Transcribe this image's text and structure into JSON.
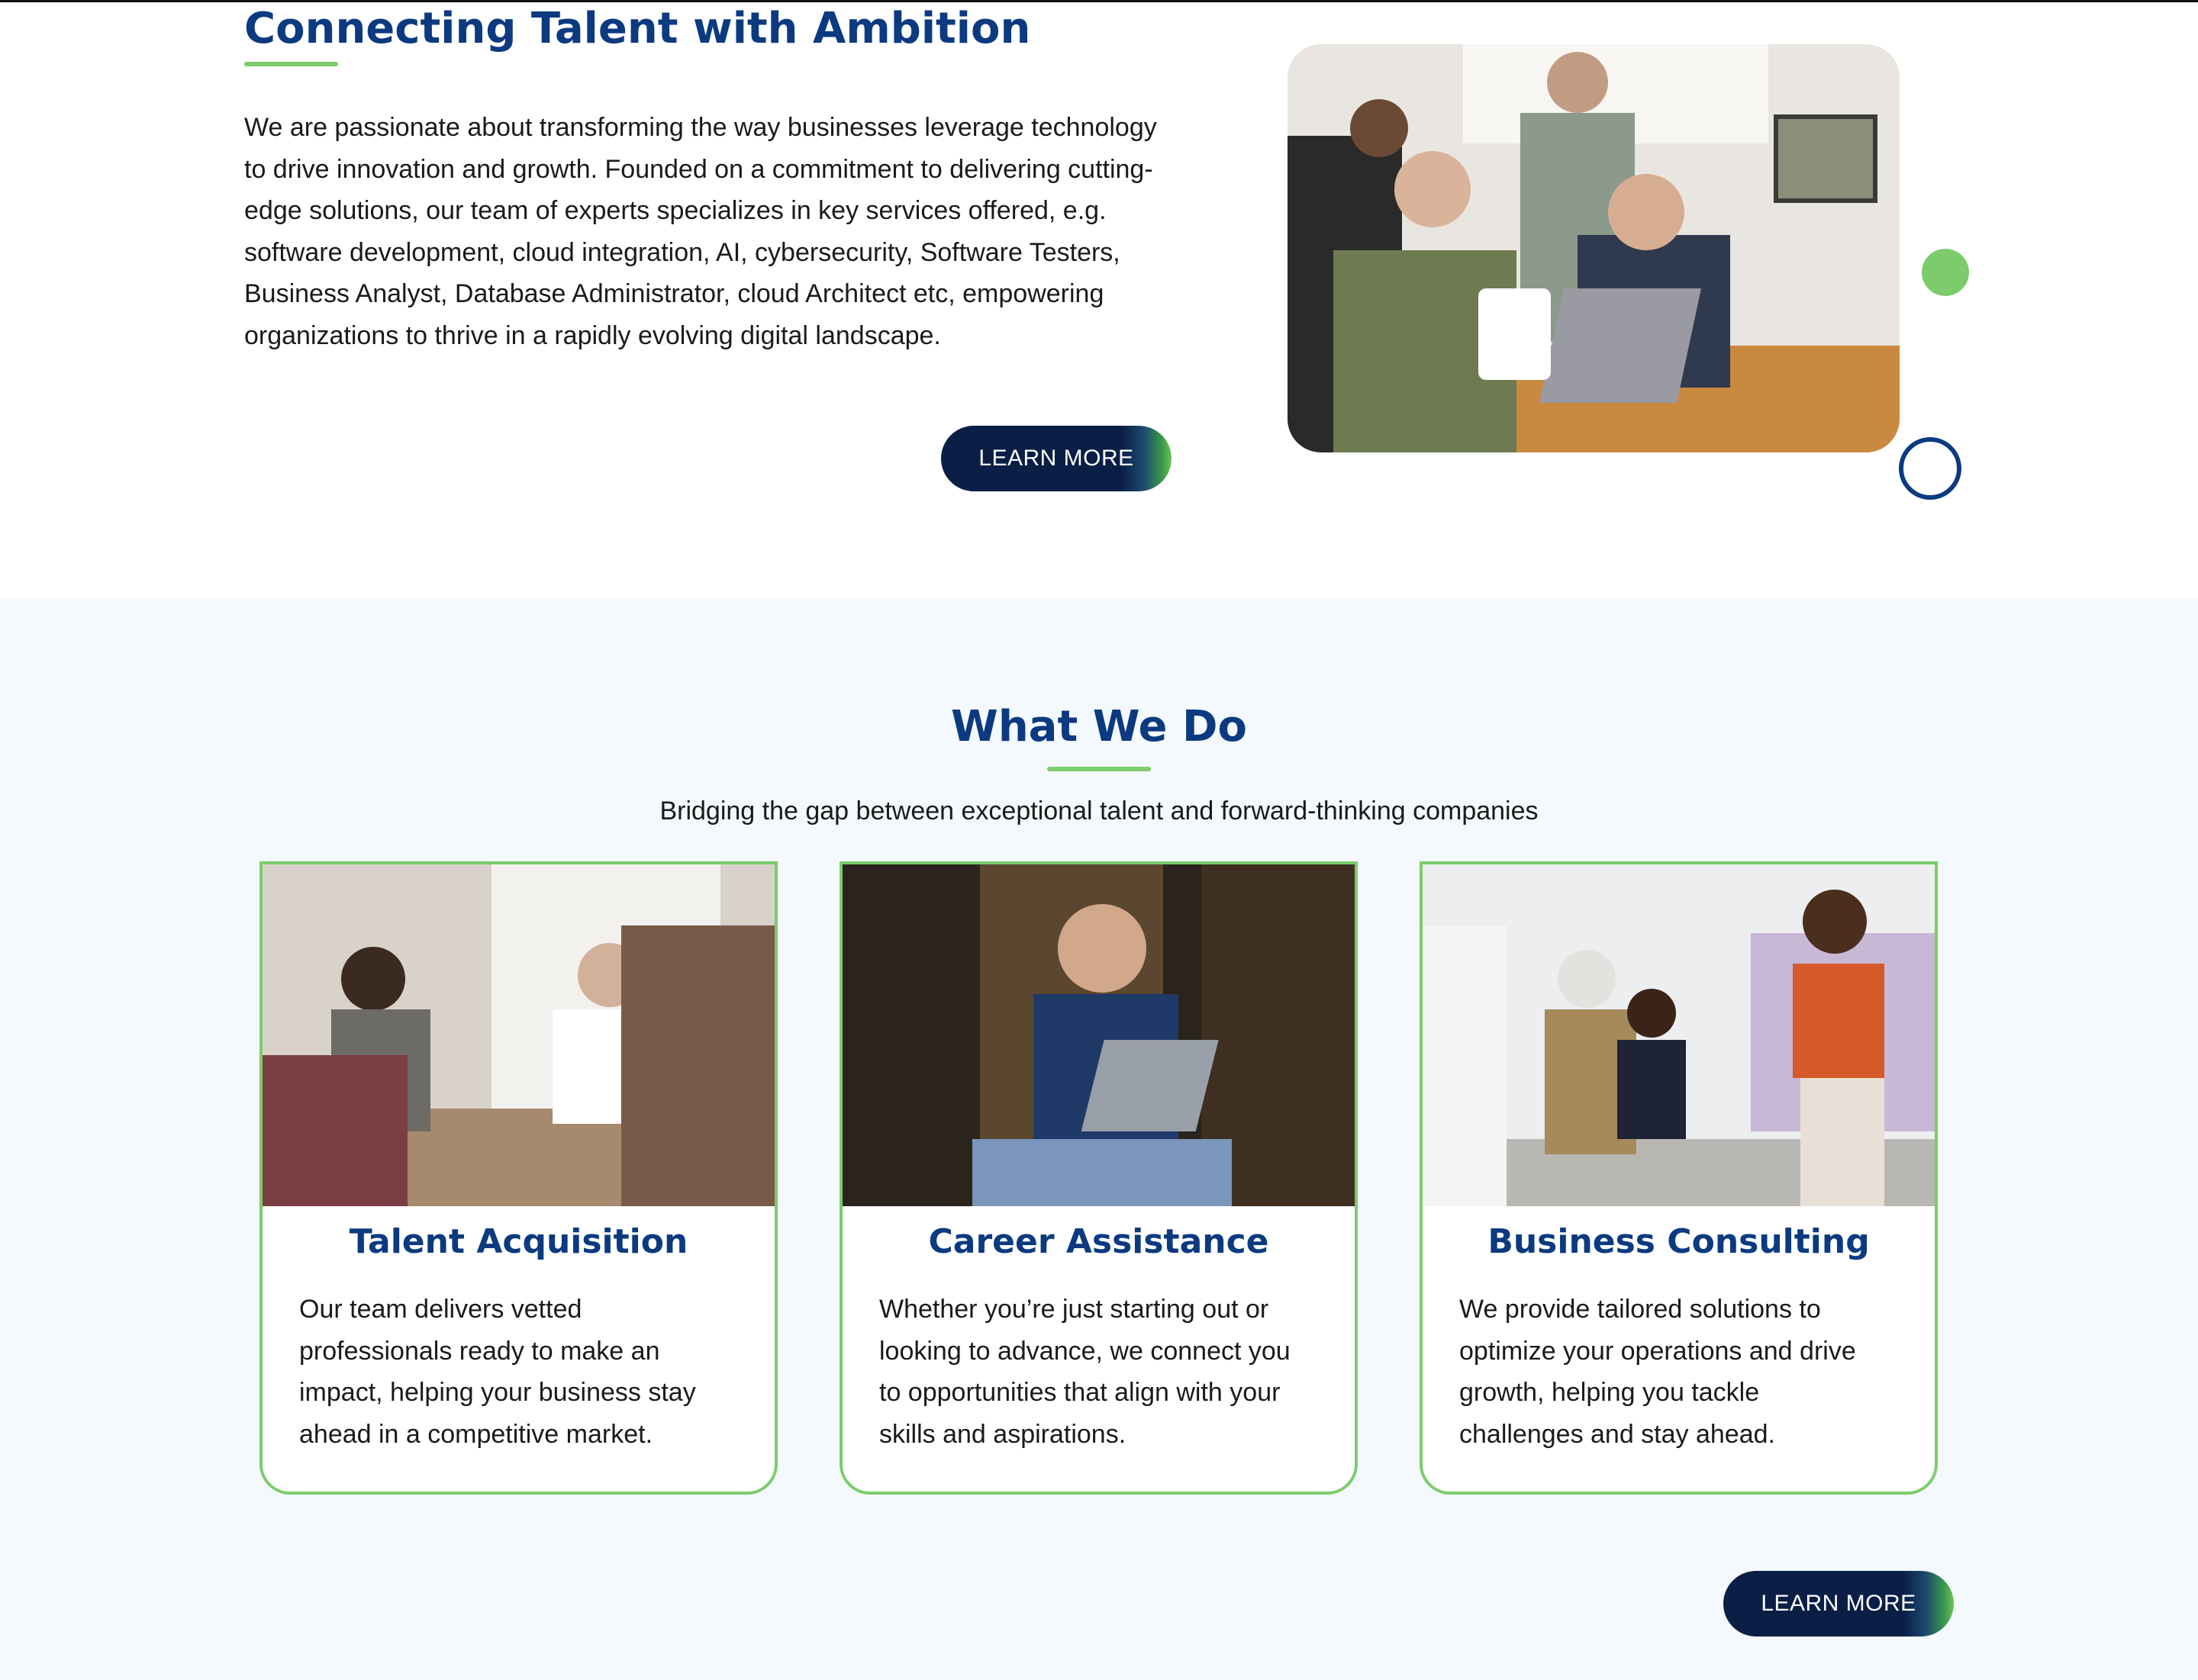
{
  "about": {
    "title": "Connecting Talent with Ambition",
    "body": "We are passionate about transforming the way businesses leverage technology to drive innovation and growth. Founded on a commitment to delivering cutting-edge solutions, our team of experts specializes in key services offered, e.g. software development, cloud integration, AI, cybersecurity, Software Testers, Business Analyst, Database Administrator, cloud Architect  etc, empowering organizations to thrive in a rapidly evolving digital landscape.",
    "button_label": "LEARN MORE",
    "photo_alt": "team collaborating at a laptop"
  },
  "services": {
    "title": "What We Do",
    "subtitle": "Bridging the gap between exceptional talent and forward-thinking companies",
    "cards": [
      {
        "title": "Talent Acquisition",
        "body": "Our team delivers vetted professionals ready to make an impact, helping your business stay ahead in a competitive market."
      },
      {
        "title": "Career Assistance",
        "body": "Whether you’re just starting out or looking to advance, we connect you to opportunities that align with your skills and aspirations."
      },
      {
        "title": "Business Consulting",
        "body": "We provide tailored solutions to optimize your operations and drive growth, helping you tackle challenges and stay ahead."
      }
    ],
    "button_label": "LEARN MORE"
  },
  "colors": {
    "navy": "#0b3a80",
    "dark_navy": "#0a1e46",
    "green": "#7ccc6c",
    "section_bg": "#f4f9fd"
  }
}
